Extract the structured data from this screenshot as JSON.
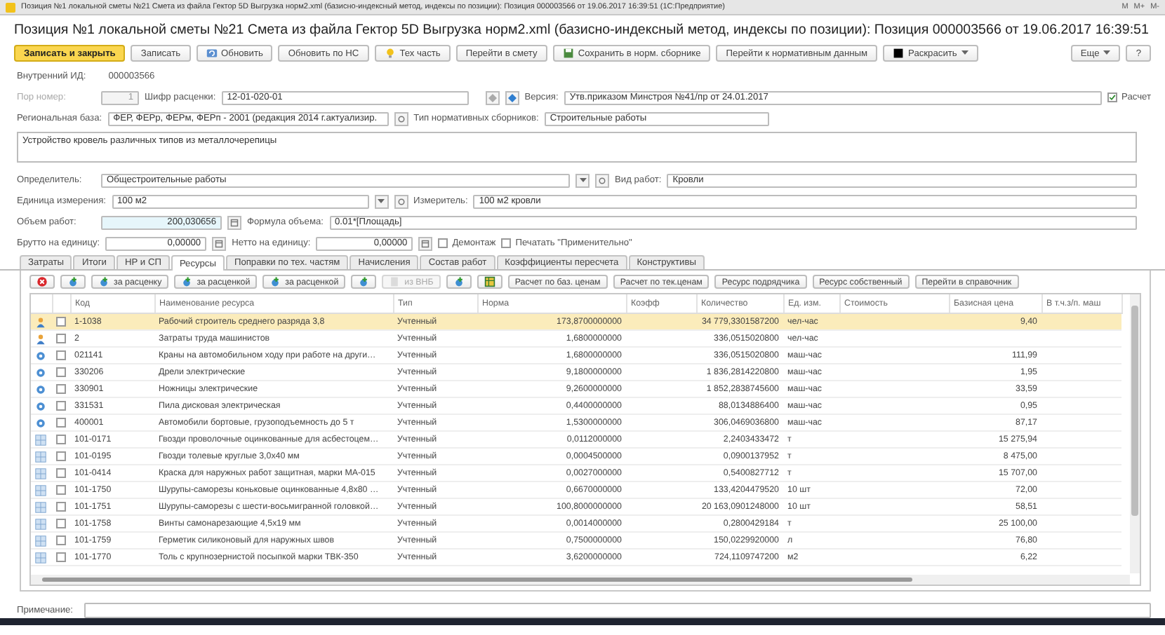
{
  "window": {
    "title": "Позиция №1 локальной сметы №21 Смета из файла Гектор 5D Выгрузка норм2.xml (базисно-индексный метод, индексы по позиции): Позиция 000003566 от 19.06.2017 16:39:51 (1С:Предприятие)",
    "controls": [
      "M",
      "M+",
      "M-"
    ]
  },
  "header": {
    "title": "Позиция №1 локальной сметы №21 Смета из файла Гектор 5D Выгрузка норм2.xml (базисно-индексный метод, индексы по позиции): Позиция 000003566 от 19.06.2017 16:39:51"
  },
  "toolbar": {
    "buttons": [
      {
        "label": "Записать и закрыть",
        "kind": "primary"
      },
      {
        "label": "Записать",
        "kind": "plain"
      },
      {
        "label": "Обновить",
        "kind": "refresh"
      },
      {
        "label": "Обновить по НС",
        "kind": "plain"
      },
      {
        "label": "Тех часть",
        "kind": "bulb"
      },
      {
        "label": "Перейти в смету",
        "kind": "plain"
      },
      {
        "label": "Сохранить в норм. сборнике",
        "kind": "save"
      },
      {
        "label": "Перейти к нормативным данным",
        "kind": "plain"
      },
      {
        "label": "Раскрасить",
        "kind": "color"
      }
    ],
    "more": "Еще",
    "help": "?"
  },
  "form": {
    "internal_id": {
      "label": "Внутренний ИД:",
      "value": "000003566"
    },
    "por_nomer": {
      "label": "Пор номер:",
      "value": "1",
      "disabled": true
    },
    "shifr": {
      "label": "Шифр расценки:",
      "value": "12-01-020-01"
    },
    "version": {
      "label": "Версия:",
      "value": "Утв.приказом Минстроя №41/пр от 24.01.2017"
    },
    "raschet": {
      "label": "Расчет",
      "checked": true
    },
    "regional_base": {
      "label": "Региональная база:",
      "value": "ФЕР, ФЕРр, ФЕРм, ФЕРп - 2001 (редакция 2014 г.актуализир."
    },
    "sbornik_type": {
      "label": "Тип нормативных сборников:",
      "value": "Строительные работы"
    },
    "description": {
      "value": "Устройство кровель различных типов из металлочерепицы"
    },
    "opredelitel": {
      "label": "Определитель:",
      "value": "Общестроительные работы"
    },
    "vid_rabot": {
      "label": "Вид работ:",
      "value": "Кровли"
    },
    "unit": {
      "label": "Единица измерения:",
      "value": "100 м2"
    },
    "izmeritel": {
      "label": "Измеритель:",
      "value": "100 м2 кровли"
    },
    "volume": {
      "label": "Объем работ:",
      "value": "200,030656"
    },
    "formula": {
      "label": "Формула объема:",
      "value": "0.01*[Площадь]"
    },
    "brutto": {
      "label": "Брутто на единицу:",
      "value": "0,00000"
    },
    "netto": {
      "label": "Нетто на единицу:",
      "value": "0,00000"
    },
    "demontazh": {
      "label": "Демонтаж",
      "checked": false
    },
    "print_note": {
      "label": "Печатать \"Применительно\"",
      "checked": false
    }
  },
  "tabs": [
    {
      "label": "Затраты",
      "selected": false
    },
    {
      "label": "Итоги",
      "selected": false
    },
    {
      "label": "НР и СП",
      "selected": false
    },
    {
      "label": "Ресурсы",
      "selected": true
    },
    {
      "label": "Поправки по тех. частям",
      "selected": false
    },
    {
      "label": "Начисления",
      "selected": false
    },
    {
      "label": "Состав работ",
      "selected": false
    },
    {
      "label": "Коэффициенты пересчета",
      "selected": false
    },
    {
      "label": "Конструктивы",
      "selected": false
    }
  ],
  "table_toolbar": [
    {
      "kind": "delete",
      "disabled": false
    },
    {
      "kind": "add",
      "disabled": false
    },
    {
      "kind": "add",
      "label": "за расценку",
      "disabled": false
    },
    {
      "kind": "add",
      "label": "за расценкой",
      "disabled": false
    },
    {
      "kind": "add",
      "label": "за расценкой",
      "disabled": false
    },
    {
      "kind": "add",
      "disabled": false
    },
    {
      "kind": "doc",
      "label": "из ВНБ",
      "disabled": true
    },
    {
      "kind": "add",
      "disabled": false
    },
    {
      "kind": "grid",
      "disabled": false
    },
    {
      "kind": "text",
      "label": "Расчет по баз. ценам",
      "disabled": false
    },
    {
      "kind": "text",
      "label": "Расчет по тек.ценам",
      "disabled": false
    },
    {
      "kind": "text",
      "label": "Ресурс подрядчика",
      "disabled": false
    },
    {
      "kind": "text",
      "label": "Ресурс собственный",
      "disabled": false
    },
    {
      "kind": "text",
      "label": "Перейти в справочник",
      "disabled": false
    }
  ],
  "table": {
    "columns": [
      "Код",
      "Наименование ресурса",
      "Тип",
      "Норма",
      "Коэфф",
      "Количество",
      "Ед. изм.",
      "Стоимость",
      "Базисная цена",
      "В т.ч.з/п. маш"
    ],
    "rows": [
      {
        "kind": "worker",
        "selected": true,
        "checked": false,
        "code": "1-1038",
        "name": "Рабочий строитель среднего разряда 3,8",
        "type": "Учтенный",
        "norma": "173,8700000000",
        "qty": "34 779,3301587200",
        "unit": "чел-час",
        "price": "9,40"
      },
      {
        "kind": "worker",
        "selected": false,
        "checked": false,
        "code": "2",
        "name": "Затраты труда машинистов",
        "type": "Учтенный",
        "norma": "1,6800000000",
        "qty": "336,0515020800",
        "unit": "чел-час"
      },
      {
        "kind": "machine",
        "selected": false,
        "checked": false,
        "code": "021141",
        "name": "Краны на автомобильном ходу при работе на други…",
        "type": "Учтенный",
        "norma": "1,6800000000",
        "qty": "336,0515020800",
        "unit": "маш-час",
        "price": "111,99"
      },
      {
        "kind": "machine",
        "selected": false,
        "checked": false,
        "code": "330206",
        "name": "Дрели электрические",
        "type": "Учтенный",
        "norma": "9,1800000000",
        "qty": "1 836,2814220800",
        "unit": "маш-час",
        "price": "1,95"
      },
      {
        "kind": "machine",
        "selected": false,
        "checked": false,
        "code": "330901",
        "name": "Ножницы электрические",
        "type": "Учтенный",
        "norma": "9,2600000000",
        "qty": "1 852,2838745600",
        "unit": "маш-час",
        "price": "33,59"
      },
      {
        "kind": "machine",
        "selected": false,
        "checked": false,
        "code": "331531",
        "name": "Пила дисковая электрическая",
        "type": "Учтенный",
        "norma": "0,4400000000",
        "qty": "88,0134886400",
        "unit": "маш-час",
        "price": "0,95"
      },
      {
        "kind": "machine",
        "selected": false,
        "checked": false,
        "code": "400001",
        "name": "Автомобили бортовые, грузоподъемность до 5 т",
        "type": "Учтенный",
        "norma": "1,5300000000",
        "qty": "306,0469036800",
        "unit": "маш-час",
        "price": "87,17"
      },
      {
        "kind": "material",
        "selected": false,
        "checked": false,
        "code": "101-0171",
        "name": "Гвозди проволочные оцинкованные для асбестоцем…",
        "type": "Учтенный",
        "norma": "0,0112000000",
        "qty": "2,2403433472",
        "unit": "т",
        "price": "15 275,94"
      },
      {
        "kind": "material",
        "selected": false,
        "checked": false,
        "code": "101-0195",
        "name": "Гвозди толевые круглые 3,0х40 мм",
        "type": "Учтенный",
        "norma": "0,0004500000",
        "qty": "0,0900137952",
        "unit": "т",
        "price": "8 475,00"
      },
      {
        "kind": "material",
        "selected": false,
        "checked": false,
        "code": "101-0414",
        "name": "Краска для наружных работ защитная, марки МА-015",
        "type": "Учтенный",
        "norma": "0,0027000000",
        "qty": "0,5400827712",
        "unit": "т",
        "price": "15 707,00"
      },
      {
        "kind": "material",
        "selected": false,
        "checked": false,
        "code": "101-1750",
        "name": "Шурупы-саморезы коньковые оцинкованные 4,8х80 …",
        "type": "Учтенный",
        "norma": "0,6670000000",
        "qty": "133,4204479520",
        "unit": "10 шт",
        "price": "72,00"
      },
      {
        "kind": "material",
        "selected": false,
        "checked": false,
        "code": "101-1751",
        "name": "Шурупы-саморезы с шести-восьмигранной головкой…",
        "type": "Учтенный",
        "norma": "100,8000000000",
        "qty": "20 163,0901248000",
        "unit": "10 шт",
        "price": "58,51"
      },
      {
        "kind": "material",
        "selected": false,
        "checked": false,
        "code": "101-1758",
        "name": "Винты самонарезающие 4,5х19 мм",
        "type": "Учтенный",
        "norma": "0,0014000000",
        "qty": "0,2800429184",
        "unit": "т",
        "price": "25 100,00"
      },
      {
        "kind": "material",
        "selected": false,
        "checked": false,
        "code": "101-1759",
        "name": "Герметик силиконовый для наружных швов",
        "type": "Учтенный",
        "norma": "0,7500000000",
        "qty": "150,0229920000",
        "unit": "л",
        "price": "76,80"
      },
      {
        "kind": "material",
        "selected": false,
        "checked": false,
        "code": "101-1770",
        "name": "Толь с крупнозернистой посыпкой марки ТВК-350",
        "type": "Учтенный",
        "norma": "3,6200000000",
        "qty": "724,1109747200",
        "unit": "м2",
        "price": "6,22"
      }
    ]
  },
  "note": {
    "label": "Примечание:"
  }
}
